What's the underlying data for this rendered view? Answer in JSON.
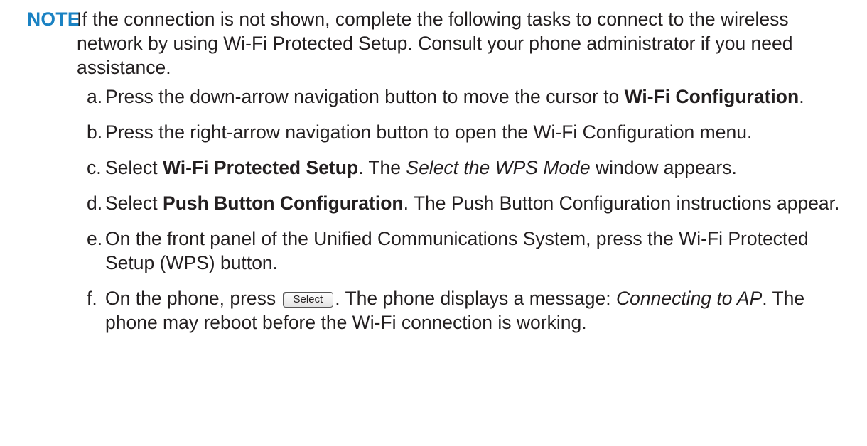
{
  "note": {
    "label": "NOTE",
    "text": "If the connection is not shown, complete the following tasks to connect to the wireless network by using Wi-Fi Protected Setup. Consult your phone administrator if you need assistance."
  },
  "steps": [
    {
      "marker": "a.",
      "t1": "Press the down-arrow navigation button to move the cursor to ",
      "b1": "Wi-Fi Configuration",
      "t2": "."
    },
    {
      "marker": "b.",
      "t1": "Press the right-arrow navigation button to open the Wi-Fi Configuration menu."
    },
    {
      "marker": "c.",
      "t1": "Select ",
      "b1": "Wi-Fi Protected Setup",
      "t2": ". The ",
      "i1": "Select the WPS Mode",
      "t3": " window appears."
    },
    {
      "marker": "d.",
      "t1": "Select ",
      "b1": "Push Button Configuration",
      "t2": ". The Push Button Configuration instructions appear."
    },
    {
      "marker": "e.",
      "t1": "On the front panel of the Unified Communications System, press the Wi-Fi Protected Setup (WPS) button."
    },
    {
      "marker": "f.",
      "t1": "On the phone, press ",
      "key": "Select",
      "t2": ". The phone displays a message: ",
      "i1": "Connecting to AP",
      "t3": ". The phone may reboot before the Wi-Fi connection is working."
    }
  ]
}
